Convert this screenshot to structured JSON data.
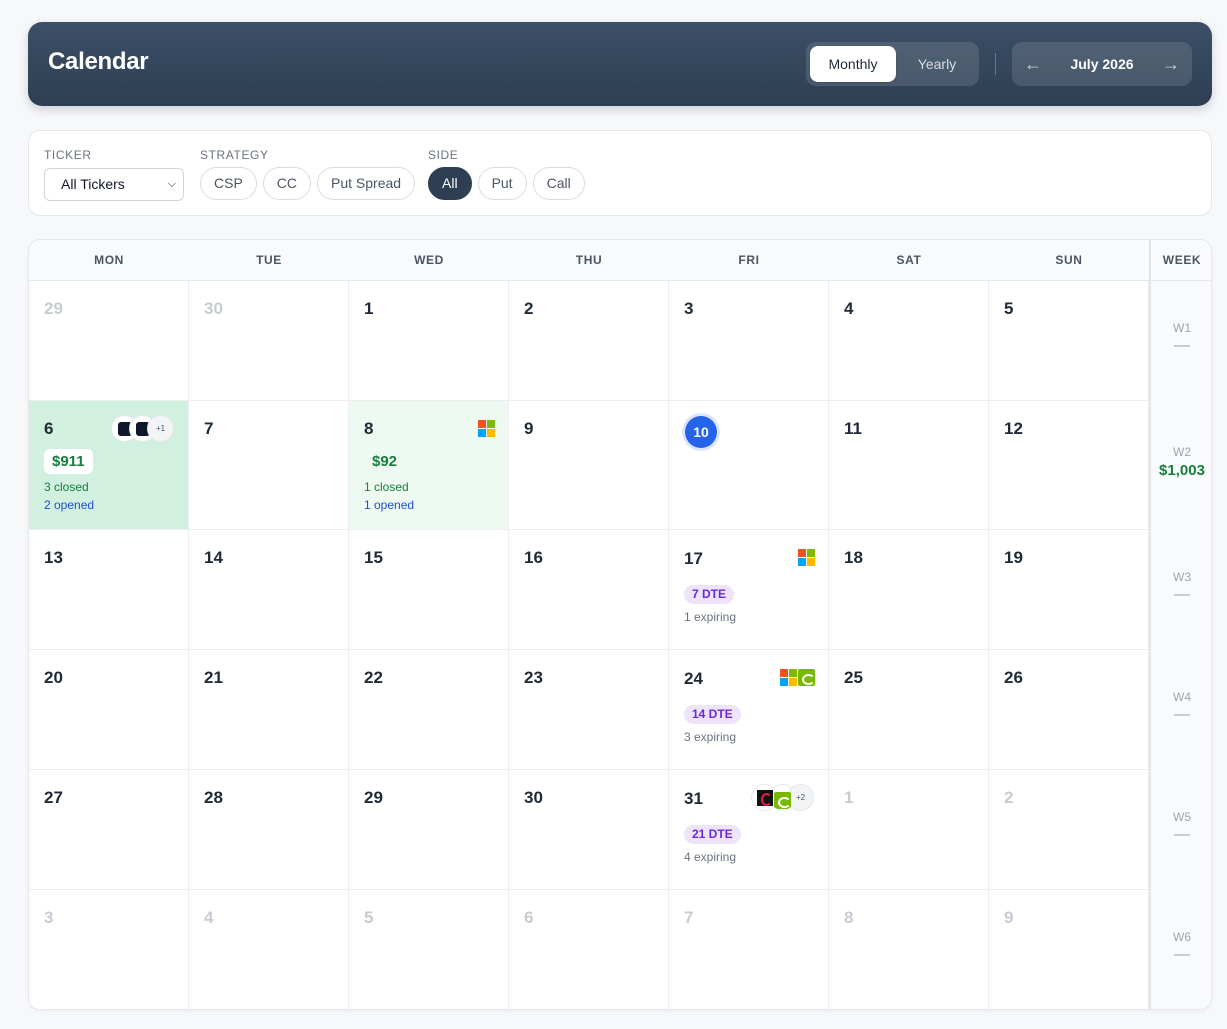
{
  "header": {
    "title": "Calendar",
    "view_toggle": {
      "monthly": "Monthly",
      "yearly": "Yearly",
      "active": "Monthly"
    },
    "month_label": "July 2026",
    "prev_icon": "←",
    "next_icon": "→"
  },
  "filters": {
    "ticker": {
      "label": "TICKER",
      "value": "All Tickers"
    },
    "strategy": {
      "label": "STRATEGY",
      "options": [
        "CSP",
        "CC",
        "Put Spread"
      ]
    },
    "side": {
      "label": "SIDE",
      "options": [
        "All",
        "Put",
        "Call"
      ],
      "active": "All"
    }
  },
  "calendar": {
    "weekdays": [
      "MON",
      "TUE",
      "WED",
      "THU",
      "FRI",
      "SAT",
      "SUN"
    ],
    "week_header": "WEEK",
    "weeks": [
      {
        "label": "W1",
        "total": "—",
        "days": [
          {
            "day": "29",
            "muted": true
          },
          {
            "day": "30",
            "muted": true
          },
          {
            "day": "1"
          },
          {
            "day": "2"
          },
          {
            "day": "3"
          },
          {
            "day": "4"
          },
          {
            "day": "5"
          }
        ]
      },
      {
        "label": "W2",
        "total": "$1,003",
        "days": [
          {
            "day": "6",
            "highlight": "green",
            "pnl": "$911",
            "closed": "3 closed",
            "opened": "2 opened",
            "icons": [
              "dark-ticker-icon",
              "dark-ticker-icon"
            ],
            "more": "+1"
          },
          {
            "day": "7"
          },
          {
            "day": "8",
            "highlight": "lightgreen",
            "pnl": "$92",
            "closed": "1 closed",
            "opened": "1 opened",
            "icons": [
              "microsoft-icon"
            ]
          },
          {
            "day": "9"
          },
          {
            "day": "10",
            "today": true
          },
          {
            "day": "11"
          },
          {
            "day": "12"
          }
        ]
      },
      {
        "label": "W3",
        "total": "—",
        "days": [
          {
            "day": "13"
          },
          {
            "day": "14"
          },
          {
            "day": "15"
          },
          {
            "day": "16"
          },
          {
            "day": "17",
            "dte": "7 DTE",
            "expiring": "1 expiring",
            "icons": [
              "microsoft-icon"
            ]
          },
          {
            "day": "18"
          },
          {
            "day": "19"
          }
        ]
      },
      {
        "label": "W4",
        "total": "—",
        "days": [
          {
            "day": "20"
          },
          {
            "day": "21"
          },
          {
            "day": "22"
          },
          {
            "day": "23"
          },
          {
            "day": "24",
            "dte": "14 DTE",
            "expiring": "3 expiring",
            "icons": [
              "microsoft-icon",
              "nvidia-icon"
            ]
          },
          {
            "day": "25"
          },
          {
            "day": "26"
          }
        ]
      },
      {
        "label": "W5",
        "total": "—",
        "days": [
          {
            "day": "27"
          },
          {
            "day": "28"
          },
          {
            "day": "29"
          },
          {
            "day": "30"
          },
          {
            "day": "31",
            "dte": "21 DTE",
            "expiring": "4 expiring",
            "icons": [
              "amd-icon",
              "nvidia-icon"
            ],
            "more": "+2"
          },
          {
            "day": "1",
            "muted": true
          },
          {
            "day": "2",
            "muted": true
          }
        ]
      },
      {
        "label": "W6",
        "total": "—",
        "days": [
          {
            "day": "3",
            "muted": true
          },
          {
            "day": "4",
            "muted": true
          },
          {
            "day": "5",
            "muted": true
          },
          {
            "day": "6",
            "muted": true
          },
          {
            "day": "7",
            "muted": true
          },
          {
            "day": "8",
            "muted": true
          },
          {
            "day": "9",
            "muted": true
          }
        ]
      }
    ]
  },
  "colors": {
    "header_bg": "#2e3f54",
    "profit_green": "#15803d",
    "opened_blue": "#1d4ed8",
    "today_blue": "#2563eb",
    "dte_purple": "#6d28d9"
  }
}
